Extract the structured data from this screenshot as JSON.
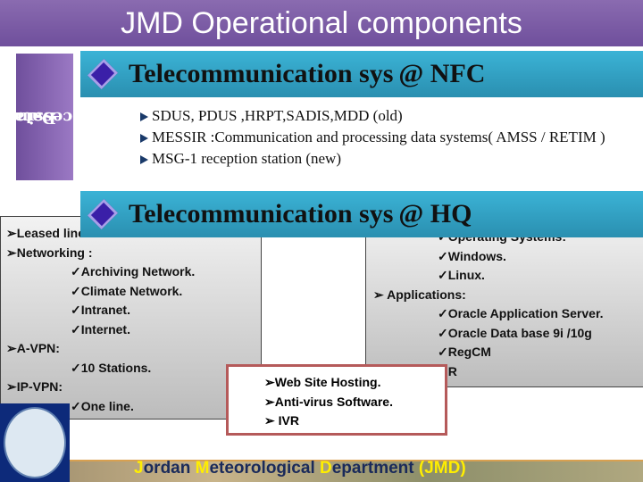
{
  "title": "JMD Operational components",
  "side_tab": {
    "line1": "Data",
    "line2": "Processing"
  },
  "nfc": {
    "title": "Telecommunication sys",
    "suffix": "@ NFC",
    "bullets": [
      "SDUS, PDUS ,HRPT,SADIS,MDD (old)",
      "MESSIR :Communication and processing data systems( AMSS / RETIM )",
      "MSG-1 reception station (new)"
    ]
  },
  "hq": {
    "title": "Telecommunication sys",
    "suffix": "@ HQ"
  },
  "left_box": {
    "items": [
      {
        "level": 1,
        "text": "➢Leased lines"
      },
      {
        "level": 1,
        "text": "➢Networking :"
      },
      {
        "level": 2,
        "text": "✓Archiving Network."
      },
      {
        "level": 2,
        "text": "✓Climate Network."
      },
      {
        "level": 2,
        "text": "✓Intranet."
      },
      {
        "level": 2,
        "text": "✓Internet."
      },
      {
        "level": 1,
        "text": "➢A-VPN:"
      },
      {
        "level": 2,
        "text": "✓10 Stations."
      },
      {
        "level": 1,
        "text": "➢IP-VPN:"
      },
      {
        "level": 2,
        "text": "✓One line."
      }
    ]
  },
  "right_box": {
    "items": [
      {
        "level": 2,
        "text": "✓Operating Systems:"
      },
      {
        "level": 2,
        "text": "✓Windows."
      },
      {
        "level": 2,
        "text": "✓Linux."
      },
      {
        "level": 1,
        "text": "➢ Applications:"
      },
      {
        "level": 2,
        "text": "✓Oracle Application Server."
      },
      {
        "level": 2,
        "text": "✓Oracle Data base 9i /10g"
      },
      {
        "level": 2,
        "text": "✓RegCM"
      },
      {
        "level": 2,
        "text": "✓R"
      }
    ]
  },
  "center_box": {
    "items": [
      "➢Web Site Hosting.",
      "➢Anti-virus Software.",
      "➢ IVR"
    ]
  },
  "footer": {
    "parts": [
      {
        "t": "J",
        "y": true
      },
      {
        "t": "ordan ",
        "y": false
      },
      {
        "t": "M",
        "y": true
      },
      {
        "t": "eteorological ",
        "y": false
      },
      {
        "t": "D",
        "y": true
      },
      {
        "t": "epartment ",
        "y": false
      },
      {
        "t": "(JMD)",
        "y": true
      }
    ]
  },
  "colors": {
    "title_bar": "#7a5aa6",
    "header_bar": "#35a7cc",
    "red_border": "#b55a5a"
  }
}
